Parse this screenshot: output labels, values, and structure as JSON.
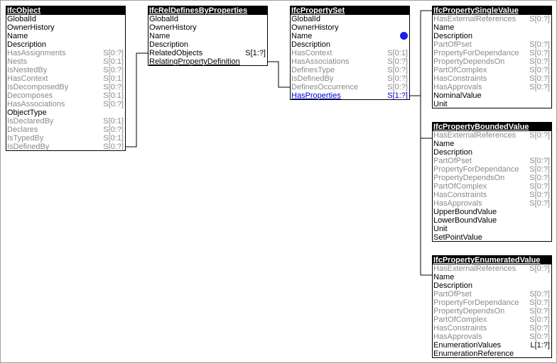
{
  "colors": {
    "background": "#ffffff",
    "header": "#000000",
    "inverse_attribute": "#8a8a8a",
    "link": "#0000d0",
    "dot": "#1e1eee",
    "frame": "#a0a0a0"
  },
  "entities": [
    {
      "name": "IfcObject",
      "attributes": [
        {
          "label": "GlobalId",
          "card": "",
          "style": "normal"
        },
        {
          "label": "OwnerHistory",
          "card": "",
          "style": "normal"
        },
        {
          "label": "Name",
          "card": "",
          "style": "normal"
        },
        {
          "label": "Description",
          "card": "",
          "style": "normal"
        },
        {
          "label": "HasAssignments",
          "card": "S[0:?]",
          "style": "inverse"
        },
        {
          "label": "Nests",
          "card": "S[0:1]",
          "style": "inverse"
        },
        {
          "label": "IsNestedBy",
          "card": "S[0:?]",
          "style": "inverse"
        },
        {
          "label": "HasContext",
          "card": "S[0:1]",
          "style": "inverse"
        },
        {
          "label": "IsDecomposedBy",
          "card": "S[0:?]",
          "style": "inverse"
        },
        {
          "label": "Decomposes",
          "card": "S[0:1]",
          "style": "inverse"
        },
        {
          "label": "HasAssociations",
          "card": "S[0:?]",
          "style": "inverse"
        },
        {
          "label": "ObjectType",
          "card": "",
          "style": "normal"
        },
        {
          "label": "IsDeclaredBy",
          "card": "S[0:1]",
          "style": "inverse"
        },
        {
          "label": "Declares",
          "card": "S[0:?]",
          "style": "inverse"
        },
        {
          "label": "IsTypedBy",
          "card": "S[0:1]",
          "style": "inverse"
        },
        {
          "label": "IsDefinedBy",
          "card": "S[0:?]",
          "style": "inverse"
        }
      ]
    },
    {
      "name": "IfcRelDefinesByProperties",
      "attributes": [
        {
          "label": "GlobalId",
          "card": "",
          "style": "normal"
        },
        {
          "label": "OwnerHistory",
          "card": "",
          "style": "normal"
        },
        {
          "label": "Name",
          "card": "",
          "style": "normal"
        },
        {
          "label": "Description",
          "card": "",
          "style": "normal"
        },
        {
          "label": "RelatedObjects",
          "card": "S[1:?]",
          "style": "normal"
        },
        {
          "label": "RelatingPropertyDefinition",
          "card": "",
          "style": "underline"
        }
      ]
    },
    {
      "name": "IfcPropertySet",
      "attributes": [
        {
          "label": "GlobalId",
          "card": "",
          "style": "normal"
        },
        {
          "label": "OwnerHistory",
          "card": "",
          "style": "normal"
        },
        {
          "label": "Name",
          "card": "",
          "style": "normal",
          "dot": true
        },
        {
          "label": "Description",
          "card": "",
          "style": "normal"
        },
        {
          "label": "HasContext",
          "card": "S[0:1]",
          "style": "inverse"
        },
        {
          "label": "HasAssociations",
          "card": "S[0:?]",
          "style": "inverse"
        },
        {
          "label": "DefinesType",
          "card": "S[0:?]",
          "style": "inverse"
        },
        {
          "label": "IsDefinedBy",
          "card": "S[0:?]",
          "style": "inverse"
        },
        {
          "label": "DefinesOccurrence",
          "card": "S[0:?]",
          "style": "inverse"
        },
        {
          "label": "HasProperties",
          "card": "S[1:?]",
          "style": "link"
        }
      ]
    },
    {
      "name": "IfcPropertySingleValue",
      "attributes": [
        {
          "label": "HasExternalReferences",
          "card": "S[0:?]",
          "style": "inverse"
        },
        {
          "label": "Name",
          "card": "",
          "style": "normal"
        },
        {
          "label": "Description",
          "card": "",
          "style": "normal"
        },
        {
          "label": "PartOfPset",
          "card": "S[0:?]",
          "style": "inverse"
        },
        {
          "label": "PropertyForDependance",
          "card": "S[0:?]",
          "style": "inverse"
        },
        {
          "label": "PropertyDependsOn",
          "card": "S[0:?]",
          "style": "inverse"
        },
        {
          "label": "PartOfComplex",
          "card": "S[0:?]",
          "style": "inverse"
        },
        {
          "label": "HasConstraints",
          "card": "S[0:?]",
          "style": "inverse"
        },
        {
          "label": "HasApprovals",
          "card": "S[0:?]",
          "style": "inverse"
        },
        {
          "label": "NominalValue",
          "card": "",
          "style": "normal"
        },
        {
          "label": "Unit",
          "card": "",
          "style": "normal"
        }
      ]
    },
    {
      "name": "IfcPropertyBoundedValue",
      "attributes": [
        {
          "label": "HasExternalReferences",
          "card": "S[0:?]",
          "style": "inverse"
        },
        {
          "label": "Name",
          "card": "",
          "style": "normal"
        },
        {
          "label": "Description",
          "card": "",
          "style": "normal"
        },
        {
          "label": "PartOfPset",
          "card": "S[0:?]",
          "style": "inverse"
        },
        {
          "label": "PropertyForDependance",
          "card": "S[0:?]",
          "style": "inverse"
        },
        {
          "label": "PropertyDependsOn",
          "card": "S[0:?]",
          "style": "inverse"
        },
        {
          "label": "PartOfComplex",
          "card": "S[0:?]",
          "style": "inverse"
        },
        {
          "label": "HasConstraints",
          "card": "S[0:?]",
          "style": "inverse"
        },
        {
          "label": "HasApprovals",
          "card": "S[0:?]",
          "style": "inverse"
        },
        {
          "label": "UpperBoundValue",
          "card": "",
          "style": "normal"
        },
        {
          "label": "LowerBoundValue",
          "card": "",
          "style": "normal"
        },
        {
          "label": "Unit",
          "card": "",
          "style": "normal"
        },
        {
          "label": "SetPointValue",
          "card": "",
          "style": "normal"
        }
      ]
    },
    {
      "name": "IfcPropertyEnumeratedValue",
      "attributes": [
        {
          "label": "HasExternalReferences",
          "card": "S[0:?]",
          "style": "inverse"
        },
        {
          "label": "Name",
          "card": "",
          "style": "normal"
        },
        {
          "label": "Description",
          "card": "",
          "style": "normal"
        },
        {
          "label": "PartOfPset",
          "card": "S[0:?]",
          "style": "inverse"
        },
        {
          "label": "PropertyForDependance",
          "card": "S[0:?]",
          "style": "inverse"
        },
        {
          "label": "PropertyDependsOn",
          "card": "S[0:?]",
          "style": "inverse"
        },
        {
          "label": "PartOfComplex",
          "card": "S[0:?]",
          "style": "inverse"
        },
        {
          "label": "HasConstraints",
          "card": "S[0:?]",
          "style": "inverse"
        },
        {
          "label": "HasApprovals",
          "card": "S[0:?]",
          "style": "inverse"
        },
        {
          "label": "EnumerationValues",
          "card": "L[1:?]",
          "style": "normal"
        },
        {
          "label": "EnumerationReference",
          "card": "",
          "style": "normal"
        }
      ]
    }
  ]
}
